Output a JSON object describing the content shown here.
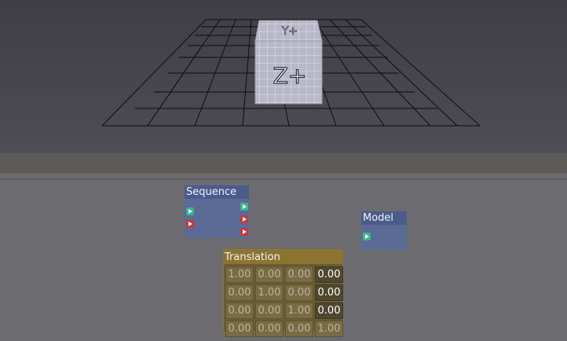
{
  "viewport": {
    "cube": {
      "front_label": "Z+",
      "top_label": "Y+"
    }
  },
  "nodes": {
    "sequence": {
      "title": "Sequence"
    },
    "model": {
      "title": "Model"
    },
    "translation": {
      "title": "Translation",
      "matrix": [
        [
          "1.00",
          "0.00",
          "0.00",
          "0.00"
        ],
        [
          "0.00",
          "1.00",
          "0.00",
          "0.00"
        ],
        [
          "0.00",
          "0.00",
          "1.00",
          "0.00"
        ],
        [
          "0.00",
          "0.00",
          "0.00",
          "1.00"
        ]
      ]
    }
  },
  "colors": {
    "flow_port": "#38b58f",
    "data_port": "#c23a3c",
    "node_blue": "#4b5c8c",
    "node_gold": "#8b7430"
  }
}
